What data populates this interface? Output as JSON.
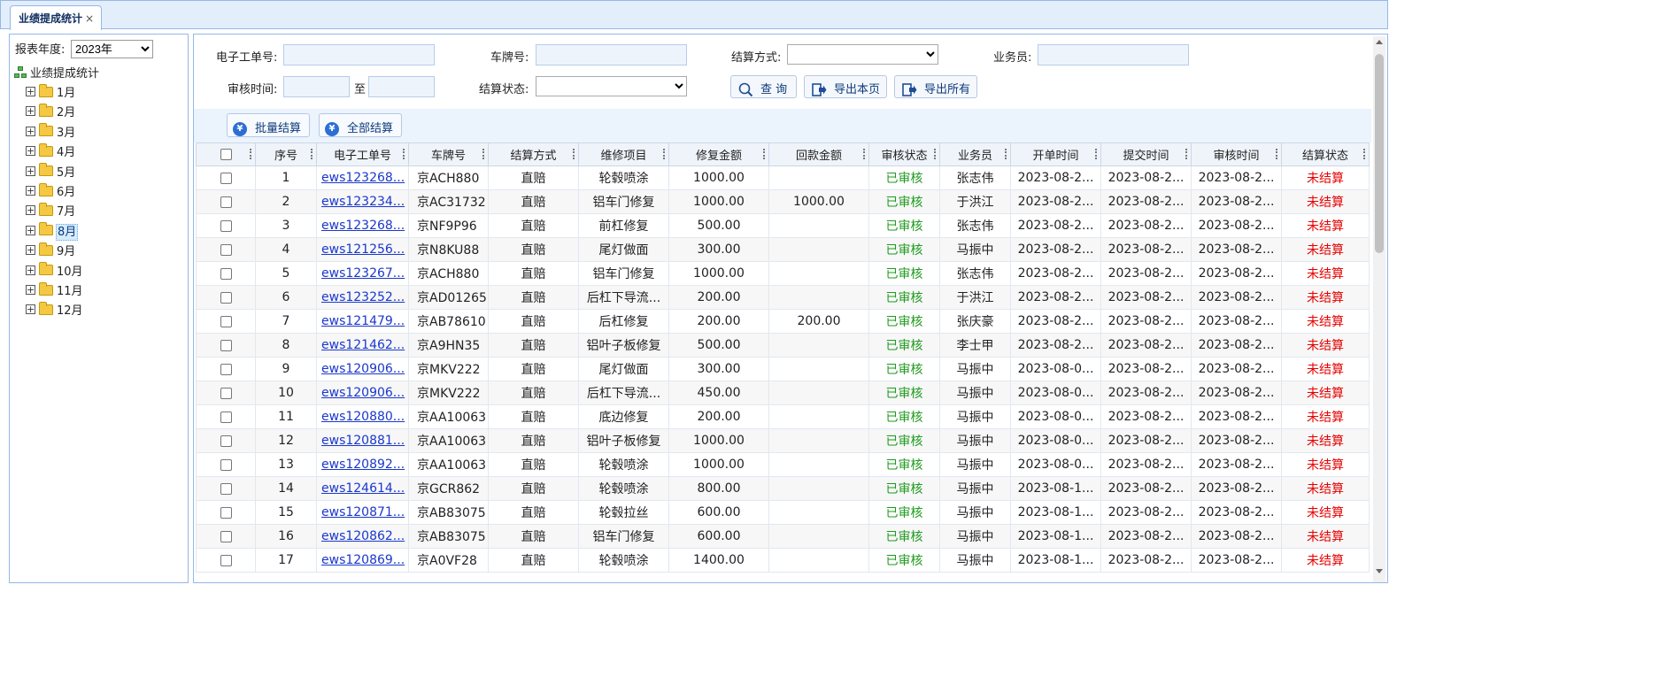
{
  "tab": {
    "label": "业绩提成统计",
    "close": "×"
  },
  "tree": {
    "year_label": "报表年度:",
    "year_value": "2023年",
    "root_label": "业绩提成统计",
    "months": [
      "1月",
      "2月",
      "3月",
      "4月",
      "5月",
      "6月",
      "7月",
      "8月",
      "9月",
      "10月",
      "11月",
      "12月"
    ],
    "selected_month": "8月"
  },
  "search": {
    "order_no_label": "电子工单号:",
    "plate_label": "车牌号:",
    "settle_method_label": "结算方式:",
    "salesman_label": "业务员:",
    "audit_time_label": "审核时间:",
    "to_label": "至",
    "settle_status_label": "结算状态:",
    "query_button": "查 询",
    "export_page_button": "导出本页",
    "export_all_button": "导出所有"
  },
  "toolbar": {
    "batch_settle": "批量结算",
    "settle_all": "全部结算"
  },
  "grid": {
    "columns": [
      "序号",
      "电子工单号",
      "车牌号",
      "结算方式",
      "维修项目",
      "修复金额",
      "回款金额",
      "审核状态",
      "业务员",
      "开单时间",
      "提交时间",
      "审核时间",
      "结算状态"
    ],
    "rows": [
      {
        "seq": "1",
        "order": "ews123268...",
        "plate": "京ACH880",
        "method": "直赔",
        "item": "轮毂喷涂",
        "amount": "1000.00",
        "refund": "",
        "audit": "已审核",
        "sales": "张志伟",
        "open": "2023-08-2...",
        "submit": "2023-08-2...",
        "audit_time": "2023-08-2...",
        "status": "未结算"
      },
      {
        "seq": "2",
        "order": "ews123234...",
        "plate": "京AC31732",
        "method": "直赔",
        "item": "铝车门修复",
        "amount": "1000.00",
        "refund": "1000.00",
        "audit": "已审核",
        "sales": "于洪江",
        "open": "2023-08-2...",
        "submit": "2023-08-2...",
        "audit_time": "2023-08-2...",
        "status": "未结算"
      },
      {
        "seq": "3",
        "order": "ews123268...",
        "plate": "京NF9P96",
        "method": "直赔",
        "item": "前杠修复",
        "amount": "500.00",
        "refund": "",
        "audit": "已审核",
        "sales": "张志伟",
        "open": "2023-08-2...",
        "submit": "2023-08-2...",
        "audit_time": "2023-08-2...",
        "status": "未结算"
      },
      {
        "seq": "4",
        "order": "ews121256...",
        "plate": "京N8KU88",
        "method": "直赔",
        "item": "尾灯做面",
        "amount": "300.00",
        "refund": "",
        "audit": "已审核",
        "sales": "马振中",
        "open": "2023-08-2...",
        "submit": "2023-08-2...",
        "audit_time": "2023-08-2...",
        "status": "未结算"
      },
      {
        "seq": "5",
        "order": "ews123267...",
        "plate": "京ACH880",
        "method": "直赔",
        "item": "铝车门修复",
        "amount": "1000.00",
        "refund": "",
        "audit": "已审核",
        "sales": "张志伟",
        "open": "2023-08-2...",
        "submit": "2023-08-2...",
        "audit_time": "2023-08-2...",
        "status": "未结算"
      },
      {
        "seq": "6",
        "order": "ews123252...",
        "plate": "京AD01265",
        "method": "直赔",
        "item": "后杠下导流...",
        "amount": "200.00",
        "refund": "",
        "audit": "已审核",
        "sales": "于洪江",
        "open": "2023-08-2...",
        "submit": "2023-08-2...",
        "audit_time": "2023-08-2...",
        "status": "未结算"
      },
      {
        "seq": "7",
        "order": "ews121479...",
        "plate": "京AB78610",
        "method": "直赔",
        "item": "后杠修复",
        "amount": "200.00",
        "refund": "200.00",
        "audit": "已审核",
        "sales": "张庆豪",
        "open": "2023-08-2...",
        "submit": "2023-08-2...",
        "audit_time": "2023-08-2...",
        "status": "未结算"
      },
      {
        "seq": "8",
        "order": "ews121462...",
        "plate": "京A9HN35",
        "method": "直赔",
        "item": "铝叶子板修复",
        "amount": "500.00",
        "refund": "",
        "audit": "已审核",
        "sales": "李士甲",
        "open": "2023-08-2...",
        "submit": "2023-08-2...",
        "audit_time": "2023-08-2...",
        "status": "未结算"
      },
      {
        "seq": "9",
        "order": "ews120906...",
        "plate": "京MKV222",
        "method": "直赔",
        "item": "尾灯做面",
        "amount": "300.00",
        "refund": "",
        "audit": "已审核",
        "sales": "马振中",
        "open": "2023-08-0...",
        "submit": "2023-08-2...",
        "audit_time": "2023-08-2...",
        "status": "未结算"
      },
      {
        "seq": "10",
        "order": "ews120906...",
        "plate": "京MKV222",
        "method": "直赔",
        "item": "后杠下导流...",
        "amount": "450.00",
        "refund": "",
        "audit": "已审核",
        "sales": "马振中",
        "open": "2023-08-0...",
        "submit": "2023-08-2...",
        "audit_time": "2023-08-2...",
        "status": "未结算"
      },
      {
        "seq": "11",
        "order": "ews120880...",
        "plate": "京AA10063",
        "method": "直赔",
        "item": "底边修复",
        "amount": "200.00",
        "refund": "",
        "audit": "已审核",
        "sales": "马振中",
        "open": "2023-08-0...",
        "submit": "2023-08-2...",
        "audit_time": "2023-08-2...",
        "status": "未结算"
      },
      {
        "seq": "12",
        "order": "ews120881...",
        "plate": "京AA10063",
        "method": "直赔",
        "item": "铝叶子板修复",
        "amount": "1000.00",
        "refund": "",
        "audit": "已审核",
        "sales": "马振中",
        "open": "2023-08-0...",
        "submit": "2023-08-2...",
        "audit_time": "2023-08-2...",
        "status": "未结算"
      },
      {
        "seq": "13",
        "order": "ews120892...",
        "plate": "京AA10063",
        "method": "直赔",
        "item": "轮毂喷涂",
        "amount": "1000.00",
        "refund": "",
        "audit": "已审核",
        "sales": "马振中",
        "open": "2023-08-0...",
        "submit": "2023-08-2...",
        "audit_time": "2023-08-2...",
        "status": "未结算"
      },
      {
        "seq": "14",
        "order": "ews124614...",
        "plate": "京GCR862",
        "method": "直赔",
        "item": "轮毂喷涂",
        "amount": "800.00",
        "refund": "",
        "audit": "已审核",
        "sales": "马振中",
        "open": "2023-08-1...",
        "submit": "2023-08-2...",
        "audit_time": "2023-08-2...",
        "status": "未结算"
      },
      {
        "seq": "15",
        "order": "ews120871...",
        "plate": "京AB83075",
        "method": "直赔",
        "item": "轮毂拉丝",
        "amount": "600.00",
        "refund": "",
        "audit": "已审核",
        "sales": "马振中",
        "open": "2023-08-1...",
        "submit": "2023-08-2...",
        "audit_time": "2023-08-2...",
        "status": "未结算"
      },
      {
        "seq": "16",
        "order": "ews120862...",
        "plate": "京AB83075",
        "method": "直赔",
        "item": "铝车门修复",
        "amount": "600.00",
        "refund": "",
        "audit": "已审核",
        "sales": "马振中",
        "open": "2023-08-1...",
        "submit": "2023-08-2...",
        "audit_time": "2023-08-2...",
        "status": "未结算"
      },
      {
        "seq": "17",
        "order": "ews120869...",
        "plate": "京A0VF28",
        "method": "直赔",
        "item": "轮毂喷涂",
        "amount": "1400.00",
        "refund": "",
        "audit": "已审核",
        "sales": "马振中",
        "open": "2023-08-1...",
        "submit": "2023-08-2...",
        "audit_time": "2023-08-2...",
        "status": "未结算"
      }
    ]
  },
  "colors": {
    "audit_ok": "#1e9a1e",
    "unsettled": "#e60000",
    "link": "#1a37cc",
    "border": "#95b8e7"
  },
  "icons": {
    "close": "close-icon",
    "folder": "folder-icon",
    "expand": "plus-box-icon",
    "tree_root": "org-tree-icon",
    "search": "search-icon",
    "export": "export-icon",
    "yen": "yen-icon"
  }
}
